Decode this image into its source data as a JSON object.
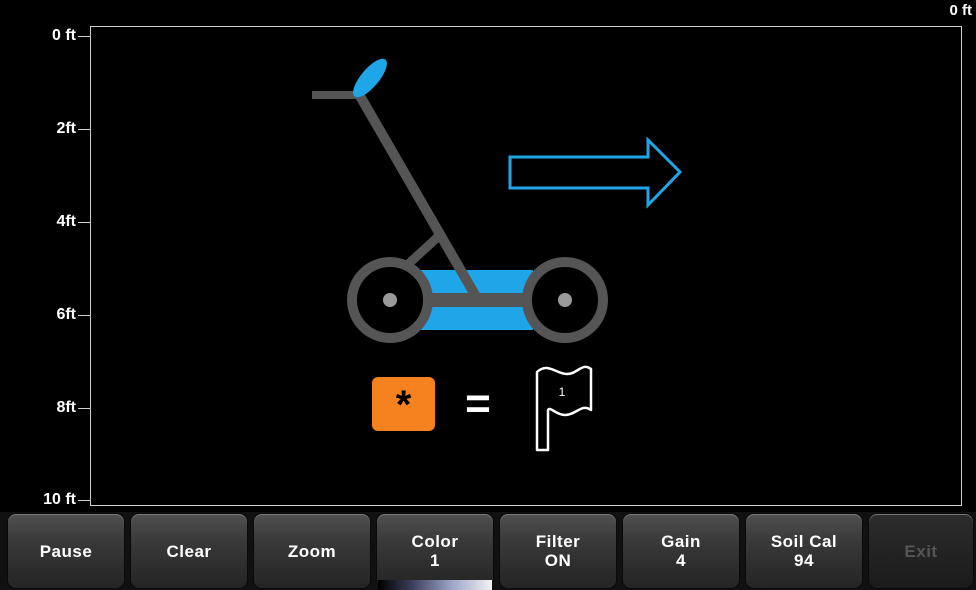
{
  "depth_axis": {
    "labels": [
      "0 ft",
      "2ft",
      "4ft",
      "6ft",
      "8ft",
      "10 ft"
    ],
    "top_right_label": "0 ft"
  },
  "legend": {
    "key_symbol": "*",
    "equals": "=",
    "flag_number": "1"
  },
  "toolbar": {
    "buttons": [
      {
        "line1": "Pause",
        "line2": ""
      },
      {
        "line1": "Clear",
        "line2": ""
      },
      {
        "line1": "Zoom",
        "line2": ""
      },
      {
        "line1": "Color",
        "line2": "1"
      },
      {
        "line1": "Filter",
        "line2": "ON"
      },
      {
        "line1": "Gain",
        "line2": "4"
      },
      {
        "line1": "Soil Cal",
        "line2": "94"
      },
      {
        "line1": "Exit",
        "line2": ""
      }
    ]
  },
  "colors": {
    "cart_frame": "#555555",
    "accent_blue": "#1fa6e8",
    "key_orange": "#f5821f",
    "arrow_outline": "#1fa6e8"
  },
  "icons": {
    "cart": "gpr-cart-icon",
    "direction": "right-arrow-icon",
    "flag": "flag-icon",
    "key": "asterisk-key-icon"
  }
}
